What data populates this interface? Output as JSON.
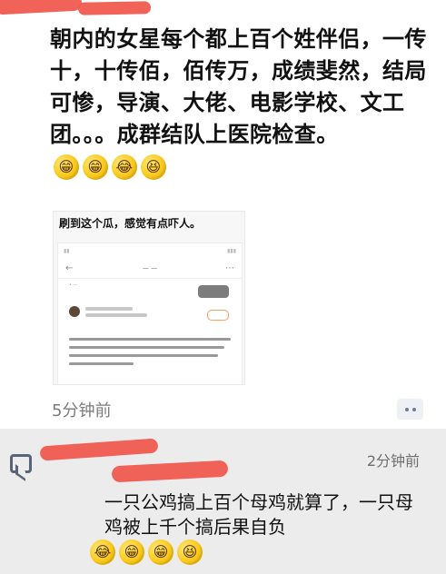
{
  "post": {
    "text": "朝内的女星每个都上百个姓伴侣，一传十，十传佰，佰传万，成绩斐然，结局可惨，导演、大佬、电影学校、文工团。。。成群结队上医院检查。",
    "emoji_names": [
      "grin-emoji",
      "grin-emoji",
      "laugh-cry-emoji",
      "smile-emoji"
    ],
    "emoji_glyphs": [
      "😁",
      "😁",
      "😂",
      "😆"
    ],
    "screenshot_caption": "刷到这个瓜，感觉有点吓人。",
    "time_ago": "5分钟前"
  },
  "comment": {
    "time": "2分钟前",
    "text": "一只公鸡搞上百个母鸡就算了，一只母鸡被上千个搞后果自负",
    "emoji_names": [
      "laugh-cry-emoji",
      "grin-emoji",
      "grin-emoji",
      "smile-emoji"
    ],
    "emoji_glyphs": [
      "😂",
      "😁",
      "😁",
      "😆"
    ]
  },
  "colors": {
    "redaction": "#f05a4f",
    "comment_bg": "#ececec",
    "meta_gray": "#7b7b7b",
    "icon_blue": "#5b6378"
  }
}
